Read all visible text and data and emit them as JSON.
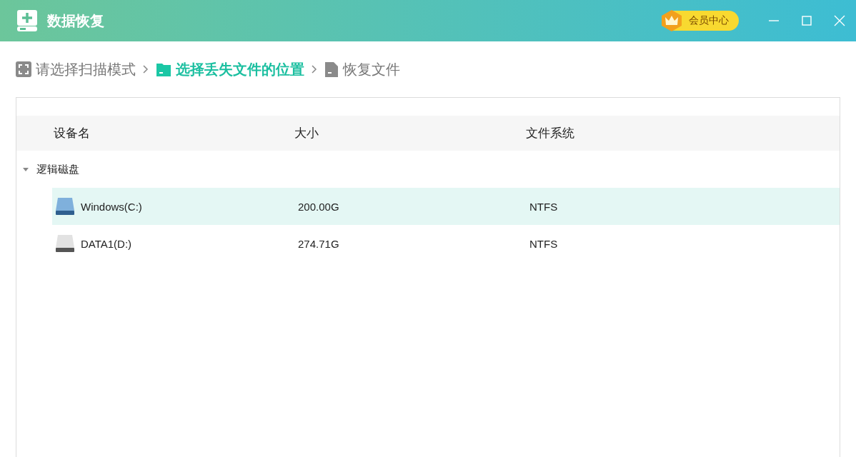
{
  "window": {
    "title": "数据恢复",
    "vip_button": "会员中心"
  },
  "breadcrumb": [
    {
      "label": "请选择扫描模式",
      "kind": "scan",
      "selected": false
    },
    {
      "label": "选择丢失文件的位置",
      "kind": "folder",
      "selected": true
    },
    {
      "label": "恢复文件",
      "kind": "file",
      "selected": false
    }
  ],
  "table": {
    "columns": [
      "设备名",
      "大小",
      "文件系统"
    ],
    "groups": [
      {
        "label": "逻辑磁盘",
        "expanded": true,
        "children": [
          {
            "name": "Windows(C:)",
            "size": "200.00G",
            "file_system": "NTFS",
            "kind": "system",
            "selected": true
          },
          {
            "name": "DATA1(D:)",
            "size": "274.71G",
            "file_system": "NTFS",
            "kind": "data",
            "selected": false
          }
        ]
      }
    ]
  }
}
